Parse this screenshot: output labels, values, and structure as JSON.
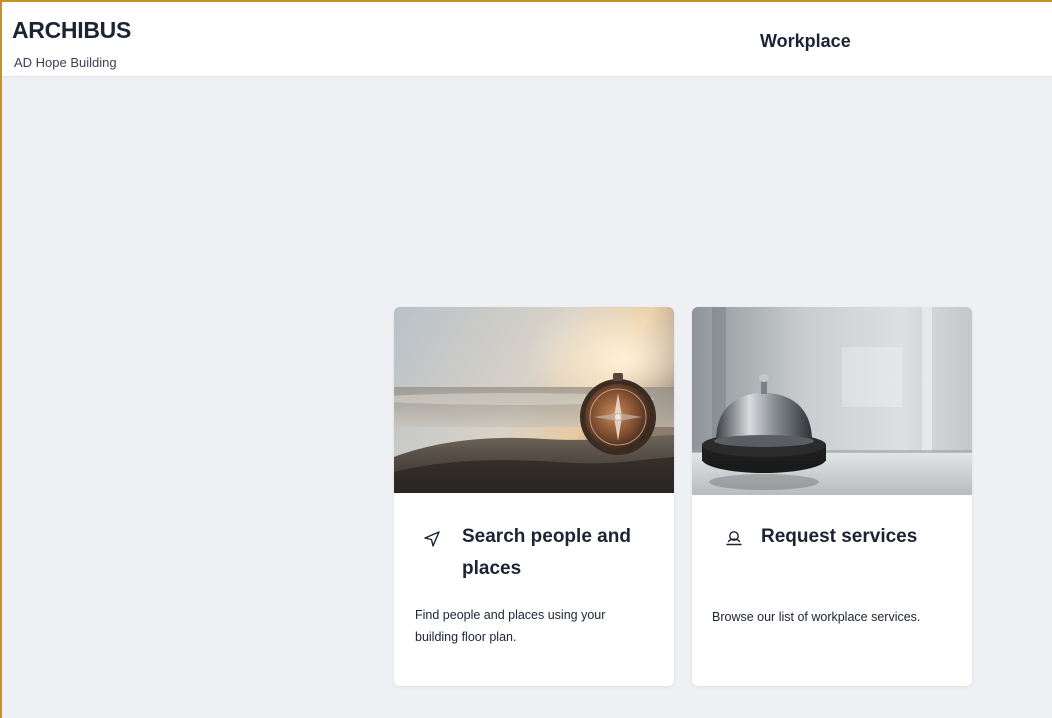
{
  "header": {
    "brand": "ARCHIBUS",
    "building": "AD Hope Building",
    "app_title": "Workplace"
  },
  "cards": [
    {
      "title": "Search people and places",
      "description": "Find people and places using your building floor plan.",
      "icon": "navigation-arrow-icon",
      "image": "compass-on-rock-photo"
    },
    {
      "title": "Request services",
      "description": "Browse our list of workplace services.",
      "icon": "concierge-bell-icon",
      "image": "service-bell-photo"
    }
  ],
  "colors": {
    "frame_border": "#c9902a",
    "page_background": "#eff0f4",
    "text": "#1c2333"
  }
}
